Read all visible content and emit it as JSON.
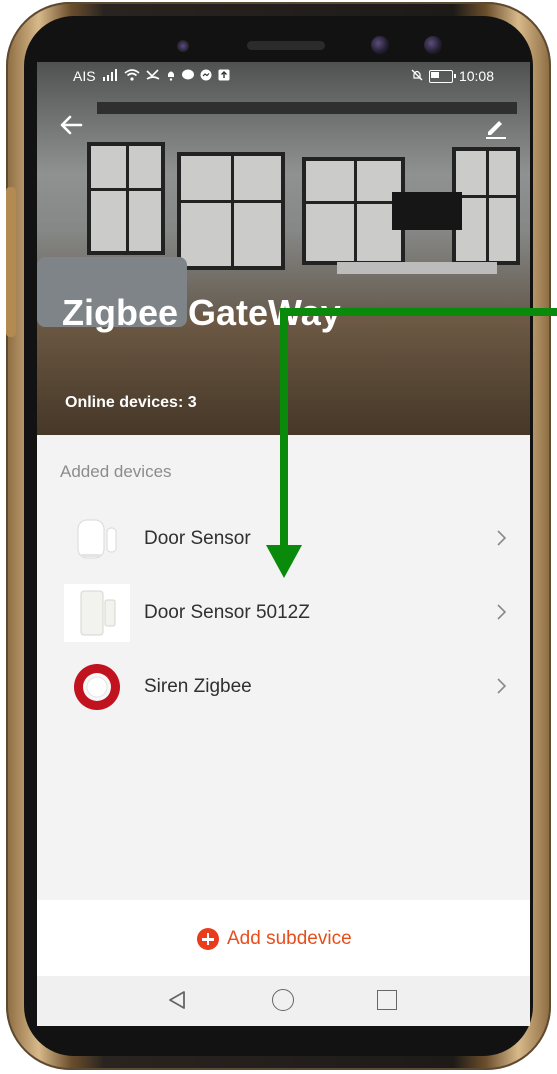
{
  "status_bar": {
    "carrier": "AIS",
    "time": "10:08"
  },
  "header": {
    "title": "Zigbee GateWay",
    "online_devices": "Online devices: 3"
  },
  "section": {
    "label": "Added devices"
  },
  "devices": [
    {
      "name": "Door Sensor",
      "icon": "door-sensor-icon"
    },
    {
      "name": "Door Sensor 5012Z",
      "icon": "door-sensor-icon"
    },
    {
      "name": "Siren Zigbee",
      "icon": "siren-icon"
    }
  ],
  "bottom": {
    "add_subdevice": "Add subdevice"
  },
  "colors": {
    "accent": "#e84e1b",
    "annotation": "#0a8a0a",
    "screen_bg": "#f3f3f3"
  }
}
